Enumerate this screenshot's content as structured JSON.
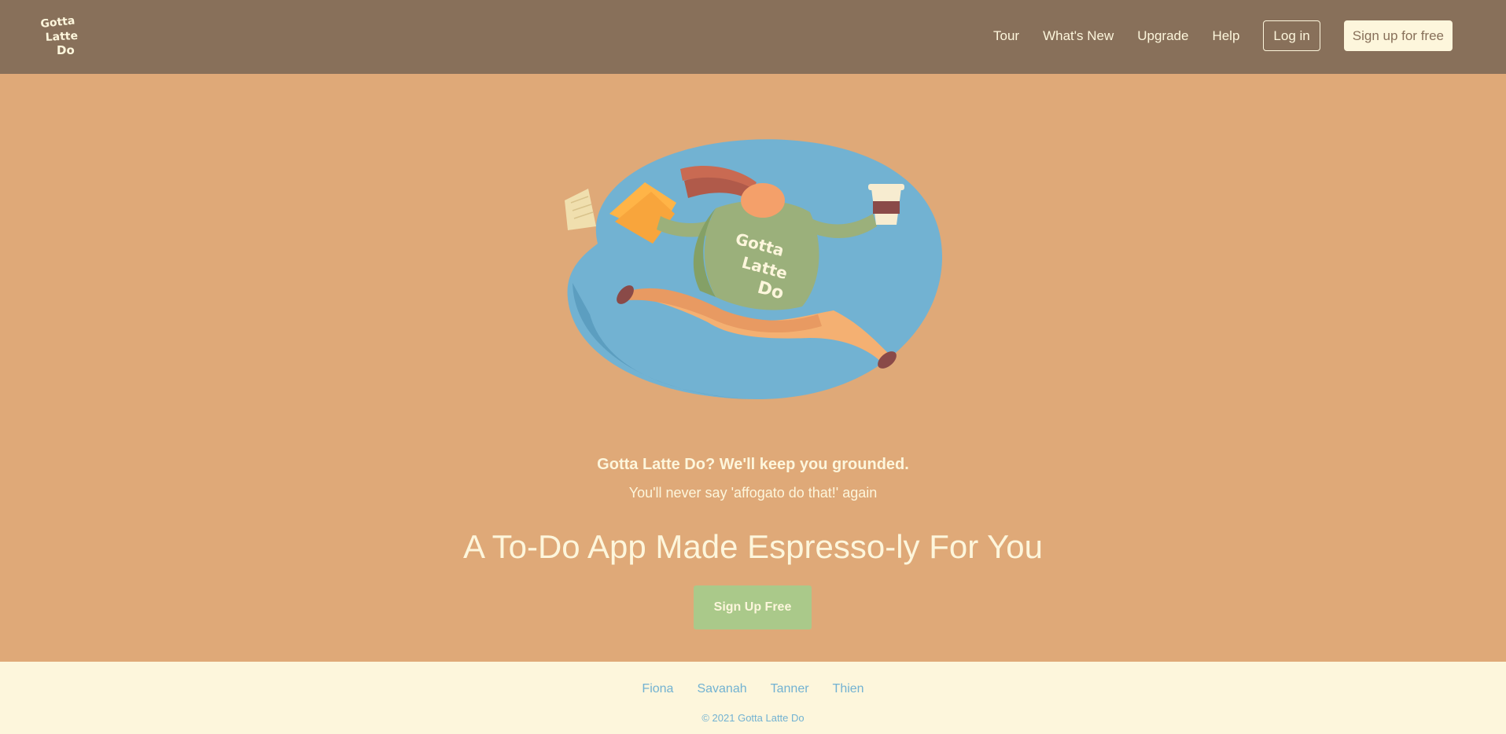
{
  "brand": {
    "logo_text": "Gotta Latte Do",
    "colors": {
      "navbar": "#88705a",
      "hero_bg": "#dfa978",
      "cream": "#fdf6dc",
      "cta_green": "#aac98a",
      "footer_link_blue": "#72b2d2"
    }
  },
  "nav": {
    "links": [
      {
        "label": "Tour"
      },
      {
        "label": "What's New"
      },
      {
        "label": "Upgrade"
      },
      {
        "label": "Help"
      }
    ],
    "login_label": "Log in",
    "signup_label": "Sign up for free"
  },
  "hero": {
    "illustration_icon": "running-coffee-person-illustration",
    "sweater_text": "Gotta Latte Do",
    "tagline": "Gotta Latte Do? We'll keep you grounded.",
    "subtagline": "You'll never say 'affogato do that!' again",
    "headline": "A To-Do App Made Espresso-ly For You",
    "cta_label": "Sign Up Free"
  },
  "footer": {
    "links": [
      {
        "label": "Fiona"
      },
      {
        "label": "Savanah"
      },
      {
        "label": "Tanner"
      },
      {
        "label": "Thien"
      }
    ],
    "copyright": "© 2021 Gotta Latte Do"
  }
}
